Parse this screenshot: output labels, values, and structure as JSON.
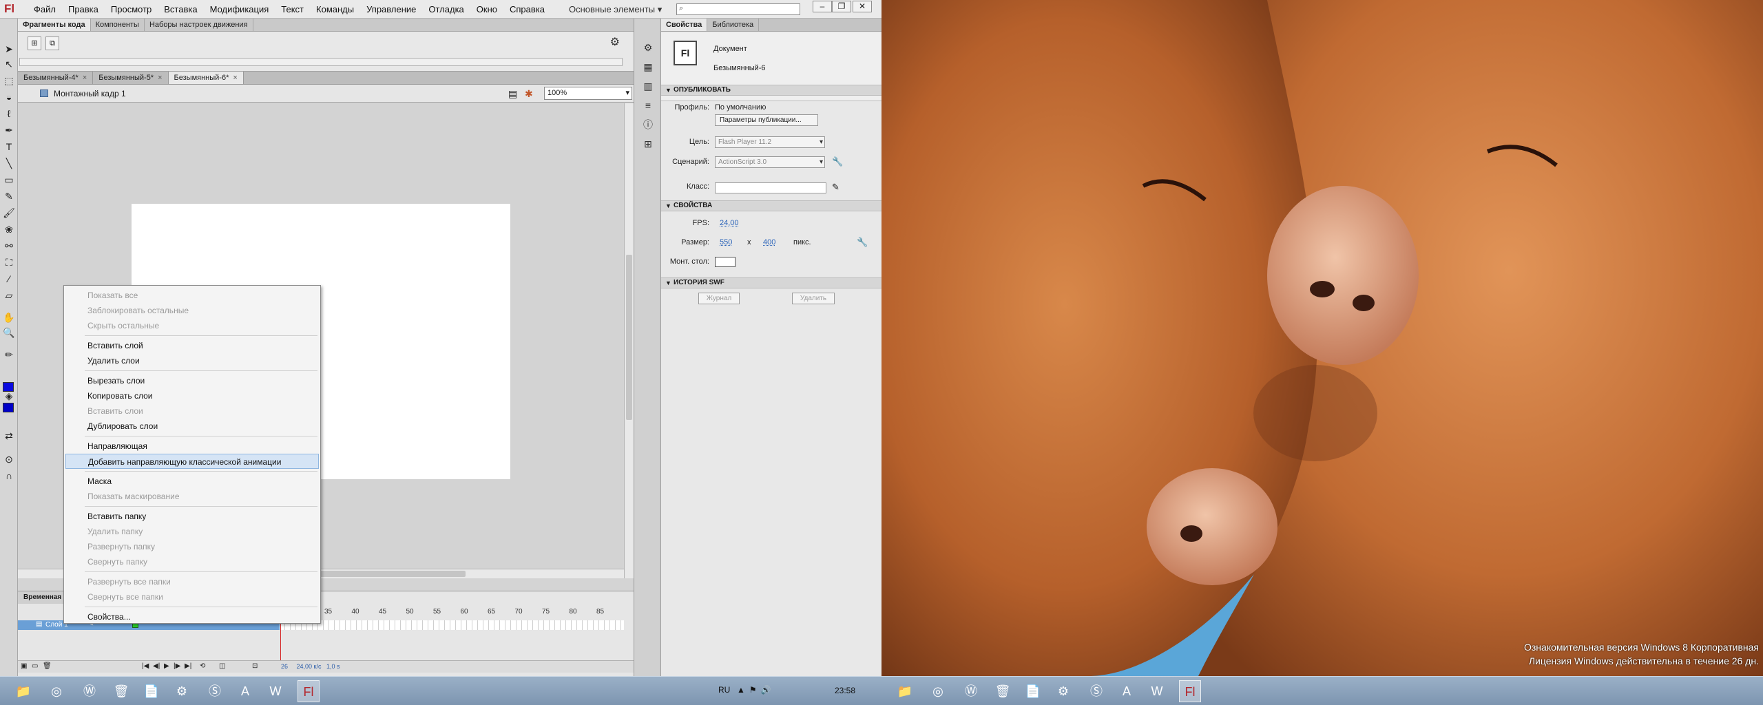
{
  "app": {
    "logo": "Fl",
    "menu": [
      "Файл",
      "Правка",
      "Просмотр",
      "Вставка",
      "Модификация",
      "Текст",
      "Команды",
      "Управление",
      "Отладка",
      "Окно",
      "Справка"
    ],
    "workspace": "Основные элементы",
    "search_placeholder": "",
    "window_buttons": [
      "–",
      "❐",
      "✕"
    ]
  },
  "snippets_panel": {
    "tabs": [
      "Фрагменты кода",
      "Компоненты",
      "Наборы настроек движения"
    ]
  },
  "document_tabs": [
    {
      "label": "Безымянный-4*"
    },
    {
      "label": "Безымянный-5*"
    },
    {
      "label": "Безымянный-6*"
    }
  ],
  "editbar": {
    "scene": "Монтажный кадр 1",
    "zoom": "100%"
  },
  "timeline": {
    "tab": "Временная",
    "layer_name": "Слой 1",
    "ruler": [
      "35",
      "40",
      "45",
      "50",
      "55",
      "60",
      "65",
      "70",
      "75",
      "80",
      "85"
    ],
    "frame": "26",
    "fps": "24,00 к/с",
    "time": "1,0 s"
  },
  "context_menu": {
    "items": [
      {
        "label": "Показать все",
        "disabled": true
      },
      {
        "label": "Заблокировать остальные",
        "disabled": true
      },
      {
        "label": "Скрыть остальные",
        "disabled": true
      },
      {
        "sep": true
      },
      {
        "label": "Вставить слой",
        "disabled": false
      },
      {
        "label": "Удалить слои",
        "disabled": false
      },
      {
        "sep": true
      },
      {
        "label": "Вырезать слои",
        "disabled": false
      },
      {
        "label": "Копировать слои",
        "disabled": false
      },
      {
        "label": "Вставить слои",
        "disabled": true
      },
      {
        "label": "Дублировать слои",
        "disabled": false
      },
      {
        "sep": true
      },
      {
        "label": "Направляющая",
        "disabled": false
      },
      {
        "label": "Добавить направляющую классической анимации",
        "disabled": false,
        "highlighted": true
      },
      {
        "sep": true
      },
      {
        "label": "Маска",
        "disabled": false
      },
      {
        "label": "Показать маскирование",
        "disabled": true
      },
      {
        "sep": true
      },
      {
        "label": "Вставить папку",
        "disabled": false
      },
      {
        "label": "Удалить папку",
        "disabled": true
      },
      {
        "label": "Развернуть папку",
        "disabled": true
      },
      {
        "label": "Свернуть папку",
        "disabled": true
      },
      {
        "sep": true
      },
      {
        "label": "Развернуть все папки",
        "disabled": true
      },
      {
        "label": "Свернуть все папки",
        "disabled": true
      },
      {
        "sep": true
      },
      {
        "label": "Свойства...",
        "disabled": false
      }
    ]
  },
  "properties": {
    "tabs": [
      "Свойства",
      "Библиотека"
    ],
    "doc_logo": "Fl",
    "doc_type": "Документ",
    "doc_name": "Безымянный-6",
    "publish": {
      "header": "ОПУБЛИКОВАТЬ",
      "profile_label": "Профиль:",
      "profile_value": "По умолчанию",
      "settings_button": "Параметры публикации...",
      "target_label": "Цель:",
      "target_value": "Flash Player 11.2",
      "script_label": "Сценарий:",
      "script_value": "ActionScript 3.0",
      "class_label": "Класс:"
    },
    "props": {
      "header": "СВОЙСТВА",
      "fps_label": "FPS:",
      "fps_value": "24,00",
      "size_label": "Размер:",
      "width": "550",
      "x": "x",
      "height": "400",
      "unit": "пикс.",
      "stage_label": "Монт. стол:"
    },
    "swf_history": {
      "header": "ИСТОРИЯ SWF",
      "log_button": "Журнал",
      "delete_button": "Удалить"
    }
  },
  "wallpaper": {
    "watermark_line1": "Ознакомительная версия Windows 8 Корпоративная",
    "watermark_line2": "Лицензия Windows действительна в течение 26 дн."
  },
  "taskbar": {
    "lang": "RU",
    "clock": "23:58"
  },
  "colors": {
    "stroke": "#0a0ae0",
    "fill": "#0000c8",
    "layer_row": "#6a9fd6"
  }
}
